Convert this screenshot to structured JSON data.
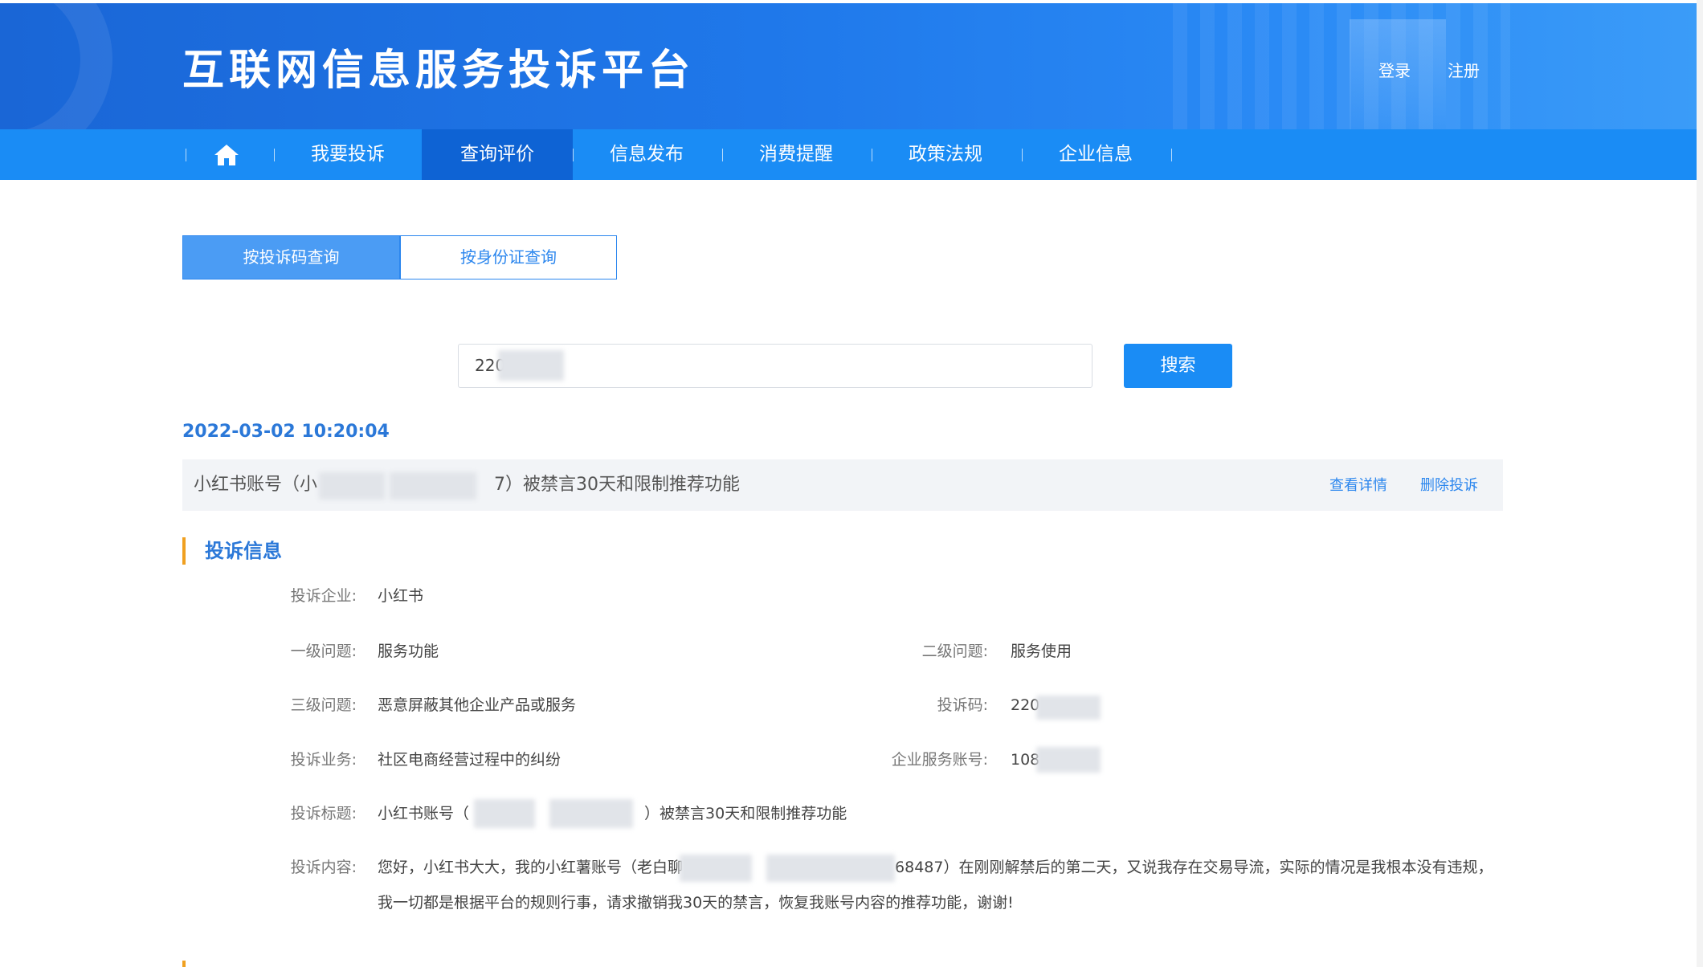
{
  "header": {
    "site_title": "互联网信息服务投诉平台",
    "login": "登录",
    "register": "注册"
  },
  "nav": {
    "home_icon": "home-icon",
    "items": [
      {
        "label": "我要投诉"
      },
      {
        "label": "查询评价",
        "active": true
      },
      {
        "label": "信息发布"
      },
      {
        "label": "消费提醒"
      },
      {
        "label": "政策法规"
      },
      {
        "label": "企业信息"
      }
    ]
  },
  "query_tabs": {
    "by_code": "按投诉码查询",
    "by_id": "按身份证查询"
  },
  "search": {
    "value": "220",
    "button": "搜索"
  },
  "result": {
    "timestamp": "2022-03-02 10:20:04",
    "title_prefix": "小红书账号（小",
    "title_suffix": "7）被禁言30天和限制推荐功能",
    "view_detail": "查看详情",
    "delete": "删除投诉"
  },
  "complaint_info": {
    "heading": "投诉信息",
    "company_label": "投诉企业:",
    "company": "小红书",
    "level1_label": "一级问题:",
    "level1": "服务功能",
    "level2_label": "二级问题:",
    "level2": "服务使用",
    "level3_label": "三级问题:",
    "level3": "恶意屏蔽其他企业产品或服务",
    "code_label": "投诉码:",
    "code": "220",
    "business_label": "投诉业务:",
    "business": "社区电商经营过程中的纠纷",
    "account_label": "企业服务账号:",
    "account": "108",
    "subject_label": "投诉标题:",
    "subject_prefix": "小红书账号（",
    "subject_suffix": "）被禁言30天和限制推荐功能",
    "content_label": "投诉内容:",
    "content_line1_prefix": "您好，小红书大大，我的小红薯账号（老白聊",
    "content_line1_suffix": "68487）在刚刚解禁后的第二天，又说我存在交易导流，实际的情况是我根本没有违规，",
    "content_line2": "我一切都是根据平台的规则行事，请求撤销我30天的禁言，恢复我账号内容的推荐功能，谢谢!"
  }
}
